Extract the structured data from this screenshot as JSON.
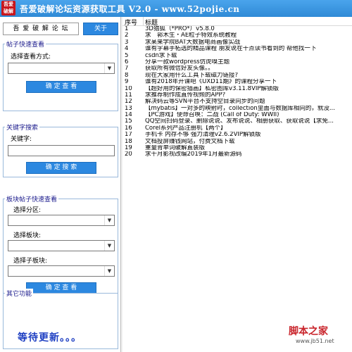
{
  "app": {
    "icon_text_line1": "吾爱",
    "icon_text_line2": "破解",
    "title": "吾爱破解论坛资源获取工具 V2.0 - www.52pojie.cn"
  },
  "brand": {
    "label": "吾 爱 破 解 论 坛",
    "about_button": "关于"
  },
  "quick_view": {
    "legend": "帖子快速查看",
    "mode_label": "选择查看方式:",
    "mode_value": "",
    "confirm_button": "确 定 查 看"
  },
  "keyword_search": {
    "legend": "关键字搜索",
    "keyword_label": "关键字:",
    "keyword_value": "",
    "confirm_button": "确 定 搜 索"
  },
  "section_view": {
    "legend": "板块帖子快速查看",
    "zone_label": "选择分区:",
    "board_label": "选择板块:",
    "subboard_label": "选择子板块:",
    "confirm_button": "确 定 查 看"
  },
  "other": {
    "legend": "其它功能",
    "waiting_text": "等待更新。。。"
  },
  "list": {
    "col_number": "序号",
    "col_title": "标题",
    "rows": [
      {
        "num": "1",
        "title": "3D猎狐（*PRO*）v5.8.0"
      },
      {
        "num": "2",
        "title": "求　郭木生・AE粒子特效系统教程"
      },
      {
        "num": "3",
        "title": "求某果学院BAT大数据电商画像实战"
      },
      {
        "num": "4",
        "title": "谁有字幕手柘选的精品课程  朋友说在十点读书看到的  帮他找一下"
      },
      {
        "num": "5",
        "title": "csdn求下载"
      },
      {
        "num": "6",
        "title": "分享一款wordpress仿虎嗅主题"
      },
      {
        "num": "7",
        "title": "获取所有微信好友头像。。"
      },
      {
        "num": "8",
        "title": "现在大家用什么工具下载磁力链接?"
      },
      {
        "num": "9",
        "title": "谁有2018年开课吧《UXD11期》的课程分享一下"
      },
      {
        "num": "10",
        "title": "【超好用的保密插画】私密图库v3.11.8VIP解锁版"
      },
      {
        "num": "11",
        "title": "求推荐制作成直传视频的APP?"
      },
      {
        "num": "12",
        "title": "解决码云等SVN平台不支持空目录同步的问题"
      },
      {
        "num": "13",
        "title": "【mybatis】一对多的映射时，collection里面与数据库相同的，就没..."
      },
      {
        "num": "14",
        "title": "【PC游戏】使命召唤：二战 (Call of Duty: WWII)"
      },
      {
        "num": "15",
        "title": "QQ空间扫码登录、删除说说、发布说说、相册获取、获取说说【求免..."
      },
      {
        "num": "16",
        "title": "Corel系列产品注册机【两个】"
      },
      {
        "num": "17",
        "title": "手机卡  内存不够  强力清理v2.6.2VIP解锁版"
      },
      {
        "num": "18",
        "title": "文档投屏赚钱网站，付费文档下载"
      },
      {
        "num": "19",
        "title": "重量背单词破解直装版"
      },
      {
        "num": "20",
        "title": "求千月影视改编2019年1月最新源码"
      }
    ]
  },
  "watermark": {
    "text": "脚本之家",
    "url": "www.jb51.net"
  }
}
